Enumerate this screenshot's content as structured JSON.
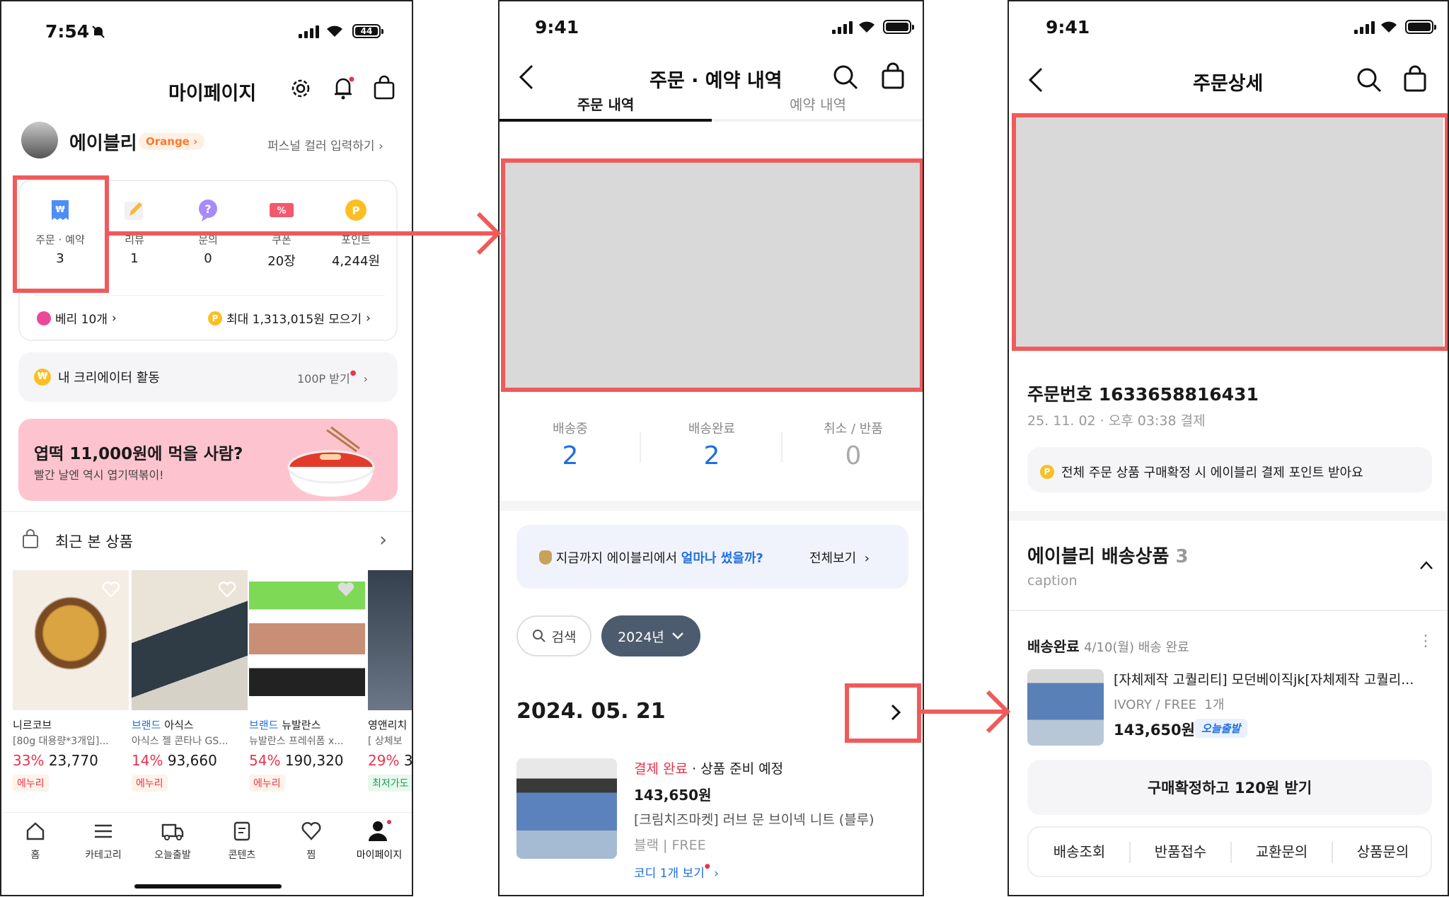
{
  "screen1": {
    "status_time": "7:54",
    "battery": "44",
    "title": "마이페이지",
    "username": "에이블리",
    "grade": "Orange",
    "personal_color_link": "퍼스널 컬러 입력하기",
    "stats": [
      {
        "label": "주문 · 예약",
        "value": "3"
      },
      {
        "label": "리뷰",
        "value": "1"
      },
      {
        "label": "문의",
        "value": "0"
      },
      {
        "label": "쿠폰",
        "value": "20장"
      },
      {
        "label": "포인트",
        "value": "4,244원"
      }
    ],
    "berry": "베리 10개",
    "max_points": "최대 1,313,015원 모으기",
    "creator_activity": "내 크리에이터 활동",
    "creator_reward": "100P 받기",
    "banner_title": "엽떡 11,000원에 먹을 사람?",
    "banner_sub": "빨간 날엔 역시 엽기떡볶이!",
    "recent_title": "최근 본 상품",
    "products": [
      {
        "brand": "니르코브",
        "brand_prefix": "",
        "name": "[80g 대용량*3개입]...",
        "discount": "33%",
        "price": "23,770",
        "tag": "에누리"
      },
      {
        "brand": "아식스",
        "brand_prefix": "브랜드",
        "name": "아식스 젤 콘타나 GS...",
        "discount": "14%",
        "price": "93,660",
        "tag": "에누리"
      },
      {
        "brand": "뉴발란스",
        "brand_prefix": "브랜드",
        "name": "뉴발란스 프레쉬폼 x...",
        "discount": "54%",
        "price": "190,320",
        "tag": "에누리"
      },
      {
        "brand": "영앤리치",
        "brand_prefix": "",
        "name": "[ 상체보",
        "discount": "29%",
        "price": "3",
        "tag": "최저가도"
      }
    ],
    "tabbar": [
      "홈",
      "카테고리",
      "오늘출발",
      "콘텐츠",
      "찜",
      "마이페이지"
    ]
  },
  "screen2": {
    "status_time": "9:41",
    "title": "주문 · 예약 내역",
    "tabs": [
      "주문 내역",
      "예약 내역"
    ],
    "counts": [
      {
        "label": "배송중",
        "value": "2"
      },
      {
        "label": "배송완료",
        "value": "2"
      },
      {
        "label": "취소 / 반품",
        "value": "0"
      }
    ],
    "spend_prefix": "지금까지 에이블리에서 ",
    "spend_highlight": "얼마나 썼을까?",
    "spend_link": "전체보기",
    "search_label": "검색",
    "year_label": "2024년",
    "order_date": "2024. 05. 21",
    "order_status_red": "결제 완료",
    "order_status_rest": " · 상품 준비 예정",
    "order_price": "143,650원",
    "order_name": "[크림치즈마켓] 러브 문 브이넥 니트 (블루)",
    "order_option": "블랙 | FREE",
    "order_coordi": "코디 1개 보기"
  },
  "screen3": {
    "status_time": "9:41",
    "title": "주문상세",
    "order_number": "주문번호 1633658816431",
    "order_datetime": "25. 11. 02 · 오후 03:38 결제",
    "point_notice": "전체 주문 상품 구매확정 시 에이블리 결제 포인트 받아요",
    "section_title": "에이블리 배송상품",
    "section_count": "3",
    "section_caption": "caption",
    "delivery_status": "배송완료",
    "delivery_date": "4/10(월) 배송 완료",
    "item_name": "[자체제작 고퀄리티] 모던베이직jk[자체제작 고퀄리...",
    "item_option": "IVORY / FREE  1개",
    "item_price": "143,650원",
    "today_badge": "오늘출발",
    "confirm_button": "구매확정하고 120원 받기",
    "actions": [
      "배송조회",
      "반품접수",
      "교환문의",
      "상품문의"
    ]
  },
  "colors": {
    "highlight": "#ef5b5b",
    "brand_red": "#e8344e",
    "accent_blue": "#1f6fe0",
    "banner_bg": "#fdc4cf",
    "year_pill": "#4d5b6e"
  }
}
